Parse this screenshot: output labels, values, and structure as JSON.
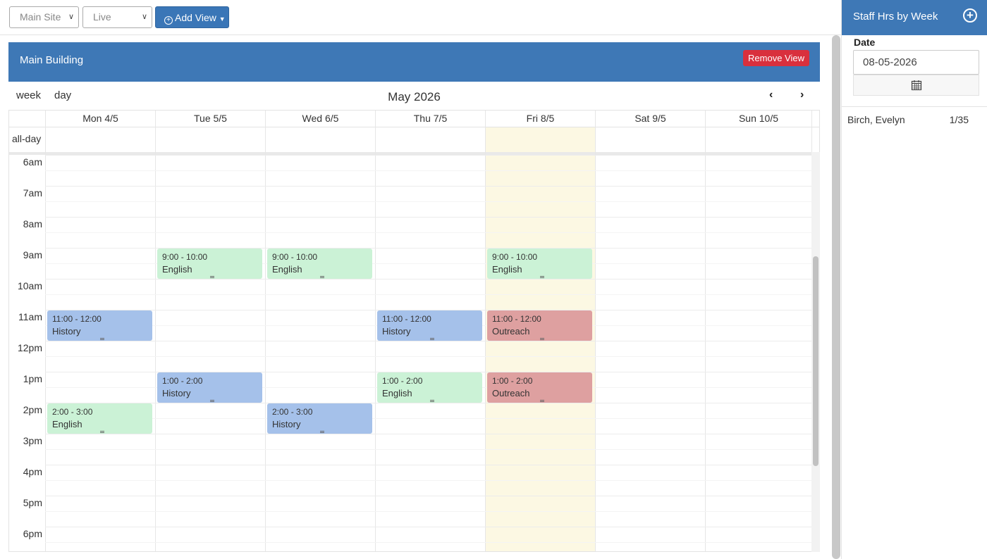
{
  "toolbar": {
    "site_select": "Main Site",
    "status_select": "Live",
    "add_view_label": "Add View"
  },
  "panel": {
    "title": "Main Building",
    "remove_view_label": "Remove View"
  },
  "calendar": {
    "view_week": "week",
    "view_day": "day",
    "title": "May 2026",
    "prev_icon": "chevron-left-icon",
    "next_icon": "chevron-right-icon",
    "allday_label": "all-day",
    "days": [
      "Mon 4/5",
      "Tue 5/5",
      "Wed 6/5",
      "Thu 7/5",
      "Fri 8/5",
      "Sat 9/5",
      "Sun 10/5"
    ],
    "today_index": 4,
    "hours": [
      "6am",
      "7am",
      "8am",
      "9am",
      "10am",
      "11am",
      "12pm",
      "1pm",
      "2pm",
      "3pm",
      "4pm",
      "5pm",
      "6pm"
    ],
    "events": [
      {
        "day": 1,
        "start": 9,
        "end": 10,
        "time": "9:00 - 10:00",
        "title": "English",
        "kind": "green"
      },
      {
        "day": 2,
        "start": 9,
        "end": 10,
        "time": "9:00 - 10:00",
        "title": "English",
        "kind": "green"
      },
      {
        "day": 4,
        "start": 9,
        "end": 10,
        "time": "9:00 - 10:00",
        "title": "English",
        "kind": "green"
      },
      {
        "day": 0,
        "start": 11,
        "end": 12,
        "time": "11:00 - 12:00",
        "title": "History",
        "kind": "blue"
      },
      {
        "day": 3,
        "start": 11,
        "end": 12,
        "time": "11:00 - 12:00",
        "title": "History",
        "kind": "blue"
      },
      {
        "day": 4,
        "start": 11,
        "end": 12,
        "time": "11:00 - 12:00",
        "title": "Outreach",
        "kind": "red"
      },
      {
        "day": 1,
        "start": 13,
        "end": 14,
        "time": "1:00 - 2:00",
        "title": "History",
        "kind": "blue"
      },
      {
        "day": 3,
        "start": 13,
        "end": 14,
        "time": "1:00 - 2:00",
        "title": "English",
        "kind": "green"
      },
      {
        "day": 4,
        "start": 13,
        "end": 14,
        "time": "1:00 - 2:00",
        "title": "Outreach",
        "kind": "red"
      },
      {
        "day": 0,
        "start": 14,
        "end": 15,
        "time": "2:00 - 3:00",
        "title": "English",
        "kind": "green"
      },
      {
        "day": 2,
        "start": 14,
        "end": 15,
        "time": "2:00 - 3:00",
        "title": "History",
        "kind": "blue"
      }
    ]
  },
  "sidebar": {
    "title": "Staff Hrs by Week",
    "date_label": "Date",
    "date_value": "08-05-2026",
    "staff": [
      {
        "name": "Birch, Evelyn",
        "hours": "1/35"
      }
    ]
  },
  "colors": {
    "primary": "#3e78b6",
    "danger": "#d9303d",
    "today": "#fcf8e3",
    "event_green": "#cbf2d6",
    "event_blue": "#a5c1ea",
    "event_red": "#dea0a0"
  }
}
